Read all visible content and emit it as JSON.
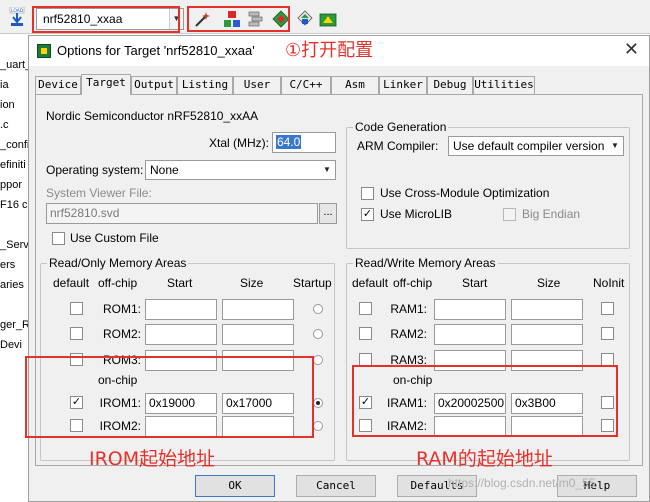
{
  "toolbar": {
    "target_name": "nrf52810_xxaa",
    "load_label": "LOAD"
  },
  "tree": [
    "_uart_",
    "ia",
    "ion",
    ".c",
    "_confi",
    "efiniti",
    "ppor",
    "F16 c",
    "_Servi",
    "ers",
    "aries",
    "ger_R",
    "Devi"
  ],
  "dialog": {
    "title": "Options for Target 'nrf52810_xxaa'",
    "annotation": "①打开配置",
    "close_glyph": "✕"
  },
  "tabs": [
    "Device",
    "Target",
    "Output",
    "Listing",
    "User",
    "C/C++",
    "Asm",
    "Linker",
    "Debug",
    "Utilities"
  ],
  "active_tab": "Target",
  "target": {
    "device_name": "Nordic Semiconductor nRF52810_xxAA",
    "xtal_label": "Xtal (MHz):",
    "xtal_value": "64.0",
    "os_label": "Operating system:",
    "os_value": "None",
    "svd_label": "System Viewer File:",
    "svd_value": "nrf52810.svd",
    "browse_label": "...",
    "custom_file_label": "Use Custom File"
  },
  "code_gen": {
    "legend": "Code Generation",
    "arm_compiler_label": "ARM Compiler:",
    "arm_compiler_value": "Use default compiler version",
    "cross_module_label": "Use Cross-Module Optimization",
    "microlib_label": "Use MicroLIB",
    "big_endian_label": "Big Endian",
    "microlib_checked": true
  },
  "rom_areas": {
    "legend": "Read/Only Memory Areas",
    "headers": {
      "default": "default",
      "offchip": "off-chip",
      "start": "Start",
      "size": "Size",
      "startup": "Startup"
    },
    "onchip_label": "on-chip",
    "rows": [
      {
        "name": "ROM1:",
        "start": "",
        "size": "",
        "checked": false,
        "startup": false
      },
      {
        "name": "ROM2:",
        "start": "",
        "size": "",
        "checked": false,
        "startup": false
      },
      {
        "name": "ROM3:",
        "start": "",
        "size": "",
        "checked": false,
        "startup": false
      },
      {
        "name": "IROM1:",
        "start": "0x19000",
        "size": "0x17000",
        "checked": true,
        "startup": true
      },
      {
        "name": "IROM2:",
        "start": "",
        "size": "",
        "checked": false,
        "startup": false
      }
    ],
    "annotation": "IROM起始地址"
  },
  "ram_areas": {
    "legend": "Read/Write Memory Areas",
    "headers": {
      "default": "default",
      "offchip": "off-chip",
      "start": "Start",
      "size": "Size",
      "noinit": "NoInit"
    },
    "onchip_label": "on-chip",
    "rows": [
      {
        "name": "RAM1:",
        "start": "",
        "size": "",
        "checked": false
      },
      {
        "name": "RAM2:",
        "start": "",
        "size": "",
        "checked": false
      },
      {
        "name": "RAM3:",
        "start": "",
        "size": "",
        "checked": false
      },
      {
        "name": "IRAM1:",
        "start": "0x20002500",
        "size": "0x3B00",
        "checked": true
      },
      {
        "name": "IRAM2:",
        "start": "",
        "size": "",
        "checked": false
      }
    ],
    "annotation": "RAM的起始地址"
  },
  "buttons": {
    "ok": "OK",
    "cancel": "Cancel",
    "defaults": "Defaults",
    "help": "Help"
  },
  "watermark": "https://blog.csdn.net/m0_55",
  "colors": {
    "annotation_red": "#e8302a",
    "selection_blue": "#3a78d0"
  }
}
